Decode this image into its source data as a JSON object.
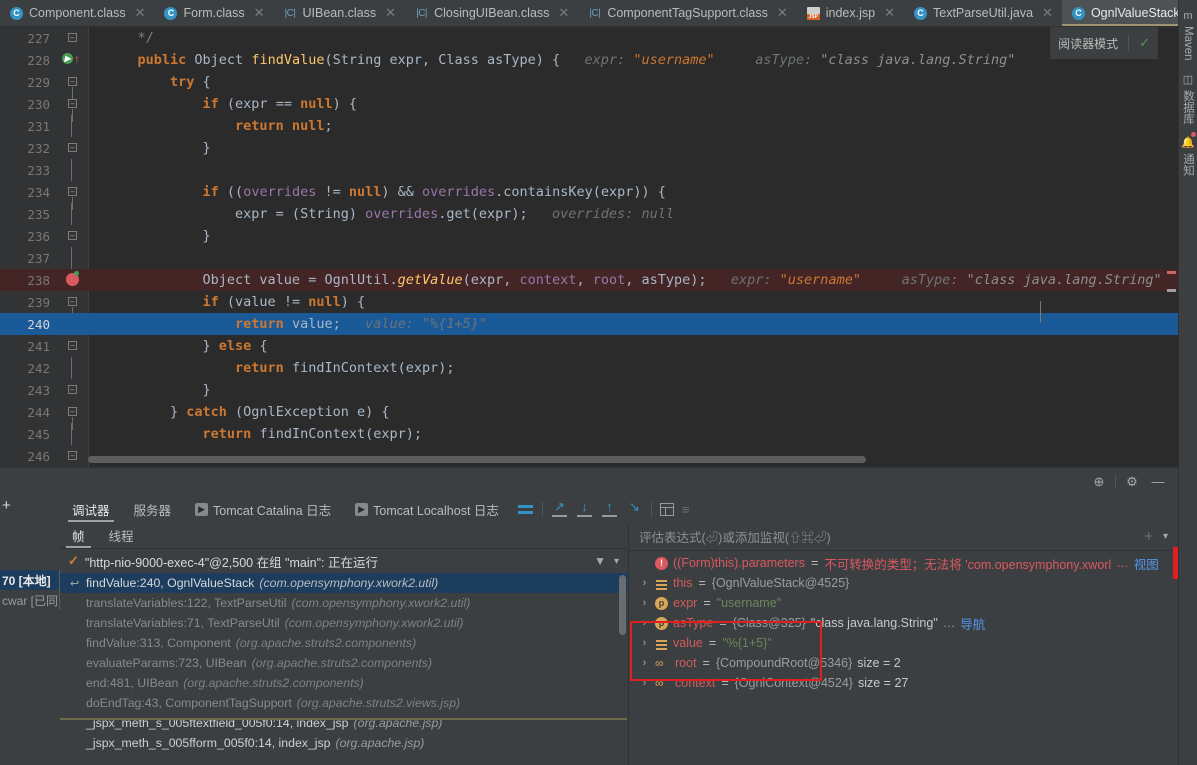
{
  "tabs": [
    {
      "label": "Component.class",
      "icon": "class-icon",
      "active": false,
      "kind": "c"
    },
    {
      "label": "Form.class",
      "icon": "class-icon",
      "active": false,
      "kind": "c"
    },
    {
      "label": "UIBean.class",
      "icon": "decompiled-class-icon",
      "active": false,
      "kind": "cls"
    },
    {
      "label": "ClosingUIBean.class",
      "icon": "decompiled-class-icon",
      "active": false,
      "kind": "cls"
    },
    {
      "label": "ComponentTagSupport.class",
      "icon": "decompiled-class-icon",
      "active": false,
      "kind": "cls"
    },
    {
      "label": "index.jsp",
      "icon": "jsp-icon",
      "active": false,
      "kind": "jsp"
    },
    {
      "label": "TextParseUtil.java",
      "icon": "class-icon",
      "active": false,
      "kind": "c"
    },
    {
      "label": "OgnlValueStack.java",
      "icon": "class-icon",
      "active": true,
      "kind": "c"
    }
  ],
  "tabbar_buttons": [
    {
      "name": "tab-list-dropdown",
      "glyph": "⌄"
    },
    {
      "name": "tab-more-options",
      "glyph": "⋮"
    }
  ],
  "editor": {
    "reader_mode_label": "阅读器模式",
    "reader_mode_check": "✓",
    "lines": [
      {
        "num": "227",
        "code": "    */",
        "gutter": "fold-collapsed"
      },
      {
        "num": "228",
        "code": "    public Object findValue(String expr, Class asType) {",
        "gutter": "fold-open",
        "run": true,
        "hints": "expr: \"username\"      asType: \"class java.lang.String\""
      },
      {
        "num": "229",
        "code": "        try {",
        "gutter": "fold-open"
      },
      {
        "num": "230",
        "code": "            if (expr == null) {",
        "gutter": "fold-open"
      },
      {
        "num": "231",
        "code": "                return null;",
        "gutter": "line"
      },
      {
        "num": "232",
        "code": "            }",
        "gutter": "fold-collapsed"
      },
      {
        "num": "233",
        "code": "",
        "gutter": "line"
      },
      {
        "num": "234",
        "code": "            if ((overrides != null) && overrides.containsKey(expr)) {",
        "gutter": "fold-open"
      },
      {
        "num": "235",
        "code": "                expr = (String) overrides.get(expr);",
        "gutter": "line",
        "hints": "overrides: null"
      },
      {
        "num": "236",
        "code": "            }",
        "gutter": "fold-collapsed"
      },
      {
        "num": "237",
        "code": "",
        "gutter": "line"
      },
      {
        "num": "238",
        "code": "            Object value = OgnlUtil.getValue(expr, context, root, asType);",
        "gutter": "breakpoint",
        "breakpoint": true,
        "hints": "expr: \"username\"      asType: \"class java.lang.String\"      value:"
      },
      {
        "num": "239",
        "code": "            if (value != null) {",
        "gutter": "fold-open"
      },
      {
        "num": "240",
        "code": "                return value;",
        "gutter": "current",
        "current": true,
        "hints": "value: \"%{1+5}\""
      },
      {
        "num": "241",
        "code": "            } else {",
        "gutter": "fold-collapsed"
      },
      {
        "num": "242",
        "code": "                return findInContext(expr);",
        "gutter": "line"
      },
      {
        "num": "243",
        "code": "            }",
        "gutter": "fold-collapsed"
      },
      {
        "num": "244",
        "code": "        } catch (OgnlException e) {",
        "gutter": "fold-open"
      },
      {
        "num": "245",
        "code": "            return findInContext(expr);",
        "gutter": "line"
      },
      {
        "num": "246",
        "code": "",
        "gutter": "fold-collapsed"
      }
    ]
  },
  "right_sidebar": [
    {
      "label": "Maven",
      "icon": "maven-icon"
    },
    {
      "label": "数据库",
      "icon": "database-icon"
    },
    {
      "label": "通知",
      "icon": "bell-icon",
      "badge": true
    }
  ],
  "toolwindow_buttons": [
    {
      "name": "settings-target-icon",
      "glyph": "⊕"
    },
    {
      "name": "gear-icon",
      "glyph": "⚙"
    },
    {
      "name": "minimize-icon",
      "glyph": "—"
    }
  ],
  "debug_toolbar": {
    "tabs": [
      {
        "label": "调试器",
        "active": true,
        "icon": null
      },
      {
        "label": "服务器",
        "active": false,
        "icon": null
      },
      {
        "label": "Tomcat Catalina 日志",
        "active": false,
        "icon": "run-square-icon"
      },
      {
        "label": "Tomcat Localhost 日志",
        "active": false,
        "icon": "run-square-icon"
      }
    ],
    "actions": [
      {
        "name": "show-execution-point-icon"
      },
      {
        "name": "step-over-icon"
      },
      {
        "name": "step-into-icon"
      },
      {
        "name": "step-out-icon"
      },
      {
        "name": "run-to-cursor-icon"
      },
      {
        "name": "evaluate-expression-icon"
      },
      {
        "name": "mute-breakpoints-icon"
      }
    ],
    "layout_icon": "layout-settings-icon"
  },
  "frames_panel": {
    "tabs": [
      {
        "label": "帧",
        "active": true
      },
      {
        "label": "线程",
        "active": false
      }
    ],
    "thread": "\"http-nio-9000-exec-4\"@2,500 在组 \"main\": 正在运行",
    "frames": [
      {
        "method": "findValue:240, OgnlValueStack",
        "pkg": "(com.opensymphony.xwork2.util)",
        "selected": true
      },
      {
        "method": "translateVariables:122, TextParseUtil",
        "pkg": "(com.opensymphony.xwork2.util)"
      },
      {
        "method": "translateVariables:71, TextParseUtil",
        "pkg": "(com.opensymphony.xwork2.util)"
      },
      {
        "method": "findValue:313, Component",
        "pkg": "(org.apache.struts2.components)"
      },
      {
        "method": "evaluateParams:723, UIBean",
        "pkg": "(org.apache.struts2.components)"
      },
      {
        "method": "end:481, UIBean",
        "pkg": "(org.apache.struts2.components)"
      },
      {
        "method": "doEndTag:43, ComponentTagSupport",
        "pkg": "(org.apache.struts2.views.jsp)"
      },
      {
        "method": "_jspx_meth_s_005ftextfield_005f0:14, index_jsp",
        "pkg": "(org.apache.jsp)",
        "bright": true
      },
      {
        "method": "_jspx_meth_s_005fform_005f0:14, index_jsp",
        "pkg": "(org.apache.jsp)",
        "bright": true
      }
    ]
  },
  "variables_panel": {
    "eval_placeholder": "评估表达式(⏎)或添加监视(⇧⌘⏎)",
    "rows": [
      {
        "kind": "error",
        "icon": "error-icon",
        "name": "((Form)this).parameters",
        "eq": "=",
        "value": "不可转换的类型；无法将 'com.opensymphony.xworl",
        "ellipsis": "…",
        "link": "视图",
        "chevron": false
      },
      {
        "kind": "field",
        "icon": "field-icon",
        "name": "this",
        "eq": "=",
        "value": "{OgnlValueStack@4525}",
        "chevron": true
      },
      {
        "kind": "param",
        "icon": "parameter-icon",
        "name": "expr",
        "eq": "=",
        "value": "\"username\"",
        "value_type": "string",
        "chevron": true,
        "boxed": true
      },
      {
        "kind": "param",
        "icon": "parameter-icon",
        "name": "asType",
        "eq": "=",
        "value": "{Class@325}",
        "value2": "\"class java.lang.String\"",
        "ellipsis": "…",
        "link": "导航",
        "chevron": true,
        "boxed": true
      },
      {
        "kind": "field",
        "icon": "field-icon",
        "name": "value",
        "eq": "=",
        "value": "\"%{1+5}\"",
        "value_type": "string",
        "chevron": true,
        "boxed": true
      },
      {
        "kind": "link",
        "icon": "chain-icon",
        "name": "root",
        "eq": "=",
        "value": "{CompoundRoot@5346}",
        "size": "size = 2",
        "chevron": true
      },
      {
        "kind": "link",
        "icon": "chain-icon",
        "name": "context",
        "eq": "=",
        "value": "{OgnlContext@4524}",
        "size": "size = 27",
        "chevron": true
      }
    ]
  },
  "left_popup": {
    "rows": [
      {
        "text": "70 [本地]",
        "selected": true
      },
      {
        "text": "cwar [已同",
        "selected": false
      }
    ]
  },
  "colors": {
    "editor_bg": "#2b2b2b",
    "panel_bg": "#3c3f41",
    "current_line": "#1a5a99",
    "breakpoint_line": "#442525",
    "accent_blue": "#3592c4",
    "error_red": "#db5860",
    "string_green": "#6a8759",
    "keyword_orange": "#cc7832",
    "field_purple": "#9876aa",
    "method_yellow": "#ffc66d",
    "highlight_box": "#e02020"
  }
}
